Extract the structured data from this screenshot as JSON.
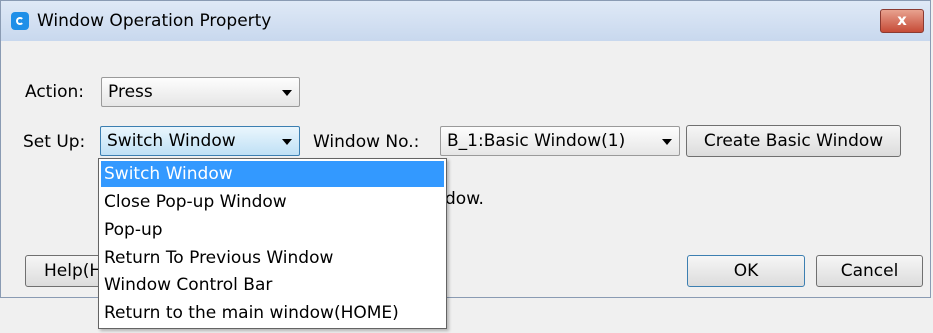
{
  "window": {
    "title": "Window Operation Property",
    "close_glyph": "x"
  },
  "action": {
    "label": "Action:",
    "value": "Press"
  },
  "setup": {
    "label": "Set Up:",
    "value": "Switch Window",
    "options": [
      "Switch Window",
      "Close Pop-up Window",
      "Pop-up",
      "Return To Previous Window",
      "Window Control Bar",
      "Return to the main window(HOME)"
    ],
    "selected_index": 0
  },
  "window_no": {
    "label": "Window No.:",
    "value": "B_1:Basic Window(1)"
  },
  "buttons": {
    "create": "Create Basic Window",
    "help": "Help(H",
    "ok": "OK",
    "cancel": "Cancel"
  },
  "description_fragment": "dow."
}
